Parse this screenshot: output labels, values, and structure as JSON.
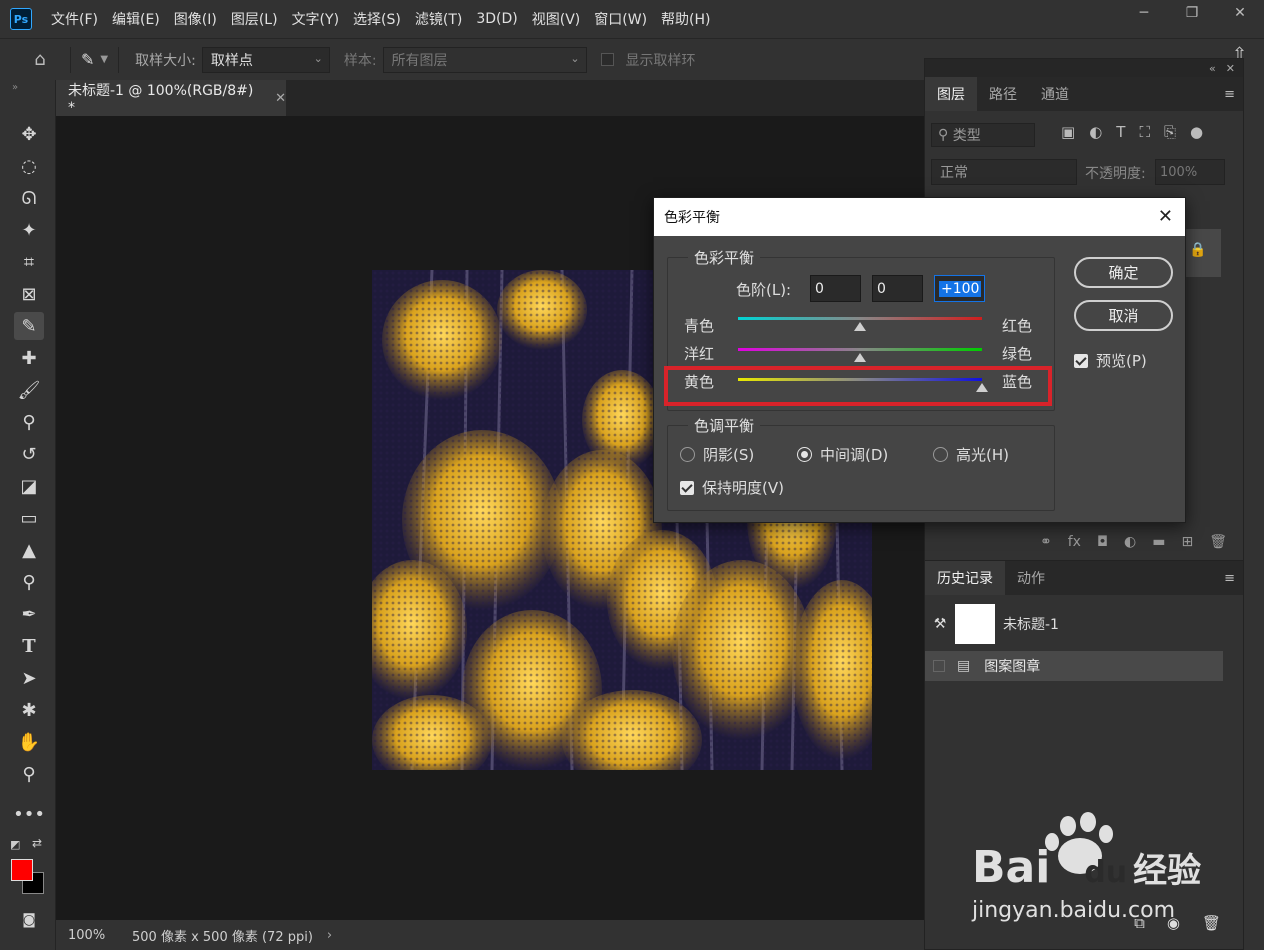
{
  "app": {
    "logo": "Ps"
  },
  "menubar": [
    "文件(F)",
    "编辑(E)",
    "图像(I)",
    "图层(L)",
    "文字(Y)",
    "选择(S)",
    "滤镜(T)",
    "3D(D)",
    "视图(V)",
    "窗口(W)",
    "帮助(H)"
  ],
  "options": {
    "sample_size_label": "取样大小:",
    "sample_size_value": "取样点",
    "sample_label": "样本:",
    "sample_value": "所有图层",
    "show_ring_label": "显示取样环"
  },
  "document": {
    "tab_title": "未标题-1 @ 100%(RGB/8#) *",
    "zoom": "100%",
    "info": "500 像素 x 500 像素 (72 ppi)"
  },
  "layers_panel": {
    "tabs": [
      "图层",
      "路径",
      "通道"
    ],
    "filter_placeholder": "类型",
    "blend_mode": "正常",
    "opacity_label": "不透明度:",
    "opacity_value": "100%"
  },
  "history_panel": {
    "tabs": [
      "历史记录",
      "动作"
    ],
    "snapshot_name": "未标题-1",
    "step_name": "图案图章"
  },
  "dialog": {
    "title": "色彩平衡",
    "color_balance_group": "色彩平衡",
    "levels_label": "色阶(L):",
    "levels": [
      "0",
      "0",
      "+100"
    ],
    "sliders": [
      {
        "left": "青色",
        "right": "红色",
        "value": 0,
        "colors": [
          "#00d4d4",
          "#d01e1e"
        ]
      },
      {
        "left": "洋红",
        "right": "绿色",
        "value": 0,
        "colors": [
          "#e000e0",
          "#00cc00"
        ]
      },
      {
        "left": "黄色",
        "right": "蓝色",
        "value": 100,
        "colors": [
          "#e8e800",
          "#1010e0"
        ]
      }
    ],
    "tone_group": "色调平衡",
    "tone_options": [
      "阴影(S)",
      "中间调(D)",
      "高光(H)"
    ],
    "tone_selected": "中间调(D)",
    "preserve_luminosity": "保持明度(V)",
    "ok_button": "确定",
    "cancel_button": "取消",
    "preview_label": "预览(P)",
    "highlight_color": "#d9232a"
  },
  "colors": {
    "foreground": "#ff0000",
    "background": "#000000"
  },
  "watermark": {
    "brand": "Bai",
    "brand2": "du",
    "cn": "经验",
    "url": "jingyan.baidu.com"
  }
}
